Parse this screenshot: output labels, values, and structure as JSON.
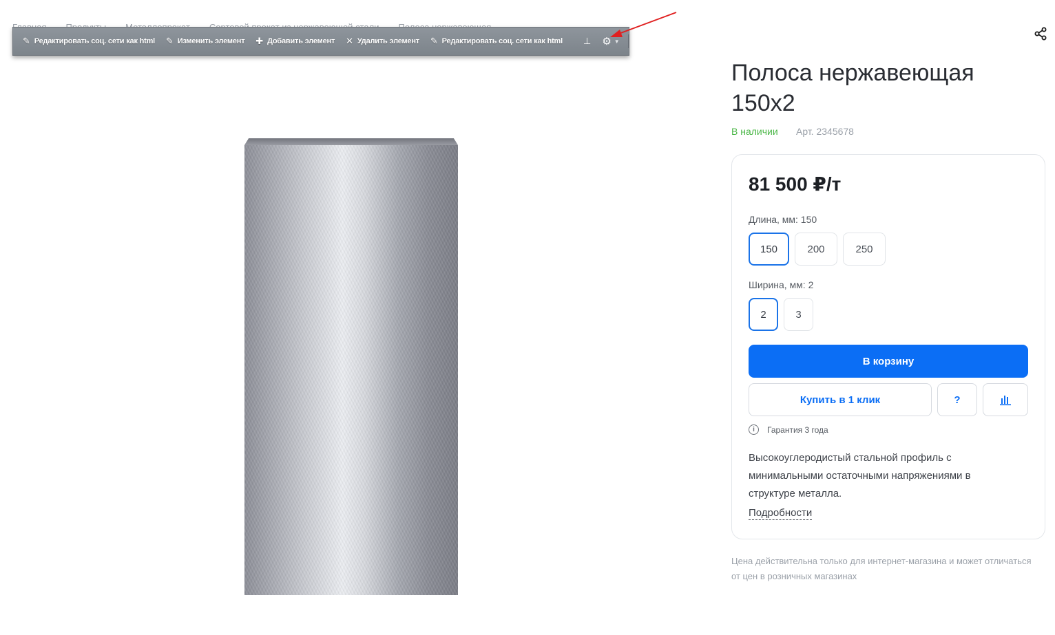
{
  "breadcrumb": [
    "Главная",
    "Продукты",
    "Металлопрокат",
    "Сортовой прокат из нержавеющей стали",
    "Полоса нержавеющая"
  ],
  "toolbar": {
    "edit_social_1": "Редактировать соц. сети как html",
    "edit_element": "Изменить элемент",
    "add_element": "Добавить элемент",
    "delete_element": "Удалить элемент",
    "edit_social_2": "Редактировать соц. сети как html"
  },
  "product": {
    "title": "Полоса нержавеющая 150х2",
    "stock": "В наличии",
    "sku": "Арт. 2345678",
    "price": "81 500 ₽/т",
    "length_label": "Длина, мм: 150",
    "length_options": [
      "150",
      "200",
      "250"
    ],
    "width_label": "Ширина, мм: 2",
    "width_options": [
      "2",
      "3"
    ],
    "cart_button": "В корзину",
    "one_click_button": "Купить в 1 клик",
    "question_button": "?",
    "warranty": "Гарантия 3 года",
    "description": "Высокоуглеродистый стальной профиль с минимальными остаточными напряжениями в структуре металла.",
    "more_link": "Подробности"
  },
  "note": "Цена действительна только для интернет-магазина и может отличаться от цен в розничных магазинах",
  "colors": {
    "accent": "#0b6ef5",
    "in_stock": "#4cb748",
    "arrow": "#e02020"
  }
}
